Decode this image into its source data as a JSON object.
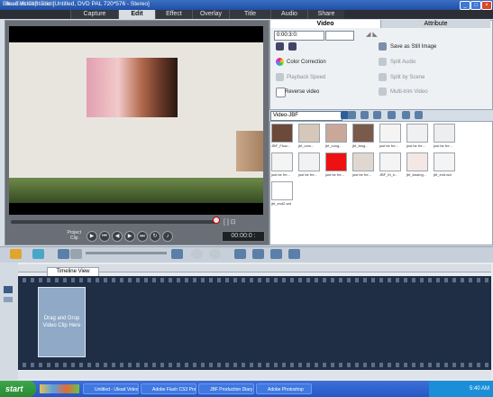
{
  "window": {
    "title": "Ulead VideoStudio [Untitled, DVD PAL 720*576 - Stereo]",
    "min": "_",
    "max": "□",
    "close": "×"
  },
  "menu": [
    "File",
    "Edit",
    "Clip",
    "Tools"
  ],
  "steps": [
    "Capture",
    "Edit",
    "Effect",
    "Overlay",
    "Title",
    "Audio",
    "Share"
  ],
  "active_step": "Edit",
  "preview": {
    "project_label": "Project",
    "clip_label": "Clip",
    "timecode": "00:00:0 :"
  },
  "options_panel": {
    "tabs": [
      "Video",
      "Attribute"
    ],
    "duration": "0:00:3:0:",
    "items_left": [
      "Color Correction",
      "Playback Speed",
      "Reverse video"
    ],
    "items_right": [
      "Save as Still Image",
      "Split Audio",
      "Split by Scene",
      "Multi-trim Video"
    ],
    "disabled_items": [
      "Playback Speed",
      "Split Audio",
      "Split by Scene",
      "Multi-trim Video"
    ]
  },
  "library": {
    "category": "Video-JBF",
    "thumbs": [
      {
        "caption": "JBF_Flow...",
        "color": "#6b4a3a"
      },
      {
        "caption": "jbf_com...",
        "color": "#d6c8b8"
      },
      {
        "caption": "jbf_cong...",
        "color": "#c9a89a"
      },
      {
        "caption": "jbf_fang...",
        "color": "#7a5a4a"
      },
      {
        "caption": "just be fre...",
        "color": "#f4f4f4"
      },
      {
        "caption": "just be fre...",
        "color": "#f0f0f0"
      },
      {
        "caption": "just be fre...",
        "color": "#eeeeee"
      },
      {
        "caption": "just be fre...",
        "color": "#f4f4f4"
      },
      {
        "caption": "just be fre...",
        "color": "#f2f2f2"
      },
      {
        "caption": "just be fre...",
        "color": "#ee1111"
      },
      {
        "caption": "just be fre...",
        "color": "#e0d8d0"
      },
      {
        "caption": "JBF_th_e...",
        "color": "#f4f4f4"
      },
      {
        "caption": "jbf_kissing...",
        "color": "#f4e8e4"
      },
      {
        "caption": "jbf_end.wvl",
        "color": "#f4f4f4"
      },
      {
        "caption": "jbf_end2.wvl",
        "color": "#ffffff"
      }
    ]
  },
  "timeline": {
    "view_label": "Timeline View",
    "dropzone": "Drag and Drop Video Clip Here"
  },
  "taskbar": {
    "start": "start",
    "tasks": [
      "Untitled - Ulead Video...",
      "Adobe Flash CS3 Prof...",
      "JBF Production Diary ...",
      "Adobe Photoshop"
    ],
    "time": "5:40 AM"
  },
  "colors": {
    "accent": "#1f4fa5",
    "menubar": "#2b2f35",
    "taskbar": "#2458c5",
    "filmstrip": "#1f2e44"
  }
}
